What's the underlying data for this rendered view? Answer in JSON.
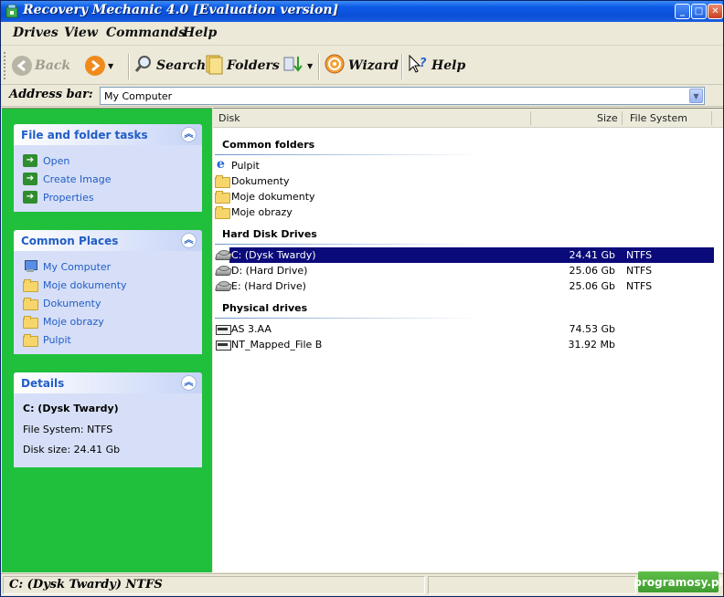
{
  "window": {
    "title": "Recovery Mechanic 4.0 [Evaluation version]",
    "minimize": "_",
    "maximize": "□",
    "close": "✕"
  },
  "menu": [
    "Drives",
    "View",
    "Commands",
    "Help"
  ],
  "toolbar": {
    "back": "Back",
    "search": "Search",
    "folders": "Folders",
    "wizard": "Wizard",
    "help": "Help"
  },
  "address": {
    "label": "Address bar:",
    "value": "My Computer"
  },
  "sidebar": {
    "tasks": {
      "title": "File and folder tasks",
      "items": [
        "Open",
        "Create Image",
        "Properties"
      ]
    },
    "places": {
      "title": "Common Places",
      "items": [
        "My Computer",
        "Moje dokumenty",
        "Dokumenty",
        "Moje obrazy",
        "Pulpit"
      ]
    },
    "details": {
      "title": "Details",
      "name": "C: (Dysk Twardy)",
      "file_system": "File System: NTFS",
      "disk_size": "Disk size: 24.41 Gb"
    }
  },
  "columns": {
    "disk": "Disk",
    "size": "Size",
    "fs": "File System"
  },
  "groups": {
    "common_folders": {
      "title": "Common folders",
      "items": [
        "Pulpit",
        "Dokumenty",
        "Moje dokumenty",
        "Moje obrazy"
      ]
    },
    "hard_disks": {
      "title": "Hard Disk Drives",
      "items": [
        {
          "name": "C: (Dysk Twardy)",
          "size": "24.41 Gb",
          "fs": "NTFS",
          "selected": true
        },
        {
          "name": "D: (Hard Drive)",
          "size": "25.06 Gb",
          "fs": "NTFS"
        },
        {
          "name": "E: (Hard Drive)",
          "size": "25.06 Gb",
          "fs": "NTFS"
        }
      ]
    },
    "physical": {
      "title": "Physical drives",
      "items": [
        {
          "name": "AS 3.AA",
          "size": "74.53 Gb",
          "fs": ""
        },
        {
          "name": "NT_Mapped_File B",
          "size": "31.92 Mb",
          "fs": ""
        }
      ]
    }
  },
  "status": {
    "text": "C: (Dysk Twardy) NTFS"
  },
  "watermark": "programosy.pl",
  "colors": {
    "sidebar_bg": "#20bf3c",
    "titlebar": "#0a4fd6",
    "selection": "#0a0a7a",
    "link": "#215dc6"
  }
}
